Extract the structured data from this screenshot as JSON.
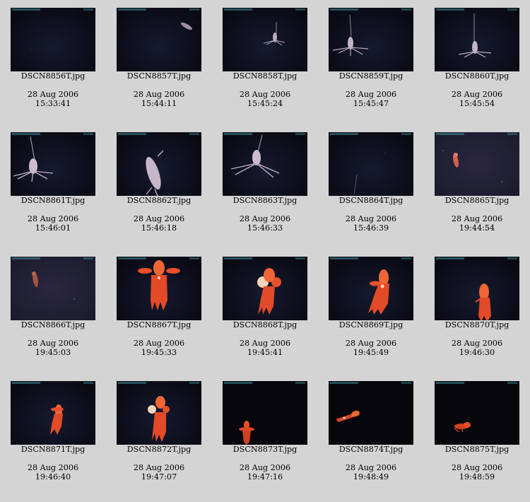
{
  "thumbnails": [
    {
      "filename": "DSCN8856T.jpg",
      "date": "28 Aug 2006",
      "time": "15:33:41"
    },
    {
      "filename": "DSCN8857T.jpg",
      "date": "28 Aug 2006",
      "time": "15:44:11"
    },
    {
      "filename": "DSCN8858T.jpg",
      "date": "28 Aug 2006",
      "time": "15:45:24"
    },
    {
      "filename": "DSCN8859T.jpg",
      "date": "28 Aug 2006",
      "time": "15:45:47"
    },
    {
      "filename": "DSCN8860T.jpg",
      "date": "28 Aug 2006",
      "time": "15:45:54"
    },
    {
      "filename": "DSCN8861T.jpg",
      "date": "28 Aug 2006",
      "time": "15:46:01"
    },
    {
      "filename": "DSCN8862T.jpg",
      "date": "28 Aug 2006",
      "time": "15:46:18"
    },
    {
      "filename": "DSCN8863T.jpg",
      "date": "28 Aug 2006",
      "time": "15:46:33"
    },
    {
      "filename": "DSCN8864T.jpg",
      "date": "28 Aug 2006",
      "time": "15:46:39"
    },
    {
      "filename": "DSCN8865T.jpg",
      "date": "28 Aug 2006",
      "time": "19:44:54"
    },
    {
      "filename": "DSCN8866T.jpg",
      "date": "28 Aug 2006",
      "time": "19:45:03"
    },
    {
      "filename": "DSCN8867T.jpg",
      "date": "28 Aug 2006",
      "time": "19:45:33"
    },
    {
      "filename": "DSCN8868T.jpg",
      "date": "28 Aug 2006",
      "time": "19:45:41"
    },
    {
      "filename": "DSCN8869T.jpg",
      "date": "28 Aug 2006",
      "time": "19:45:49"
    },
    {
      "filename": "DSCN8870T.jpg",
      "date": "28 Aug 2006",
      "time": "19:46:30"
    },
    {
      "filename": "DSCN8871T.jpg",
      "date": "28 Aug 2006",
      "time": "19:46:40"
    },
    {
      "filename": "DSCN8872T.jpg",
      "date": "28 Aug 2006",
      "time": "19:47:07"
    },
    {
      "filename": "DSCN8873T.jpg",
      "date": "28 Aug 2006",
      "time": "19:47:16"
    },
    {
      "filename": "DSCN8874T.jpg",
      "date": "28 Aug 2006",
      "time": "19:48:49"
    },
    {
      "filename": "DSCN8875T.jpg",
      "date": "28 Aug 2006",
      "time": "19:48:59"
    }
  ],
  "colors": {
    "page_background": "#d4d4d4",
    "thumb_background": "#0d0e1b",
    "squid_pale": "#c9b6c8",
    "octopus_orange": "#e8502a"
  }
}
